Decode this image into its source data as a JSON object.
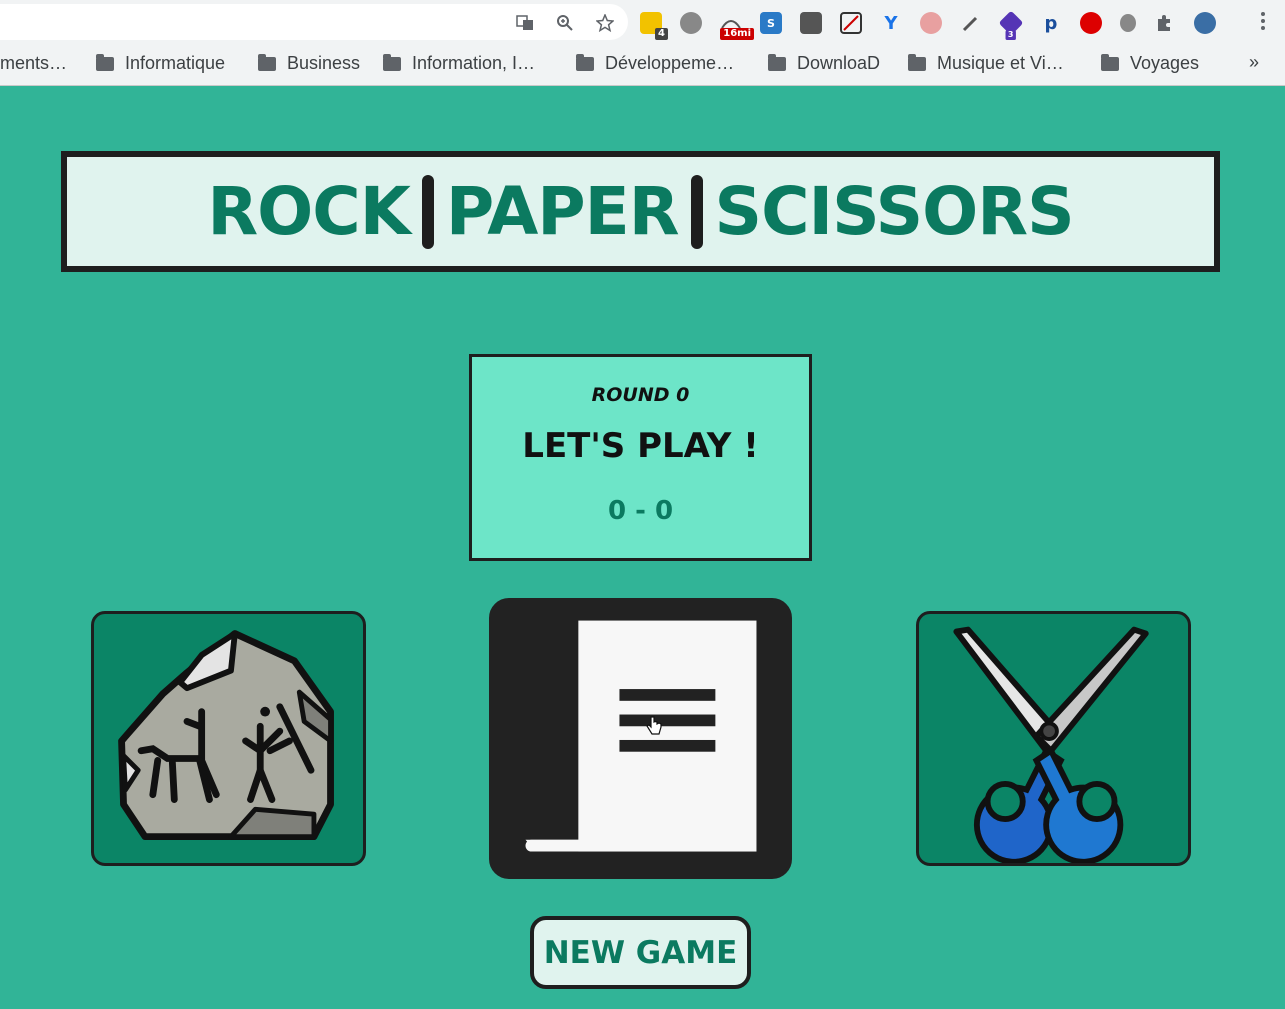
{
  "browser": {
    "bookmarks": [
      {
        "label": "ments…",
        "folder": false
      },
      {
        "label": "Informatique",
        "folder": true
      },
      {
        "label": "Business",
        "folder": true
      },
      {
        "label": "Information, I…",
        "folder": true
      },
      {
        "label": "Développeme…",
        "folder": true
      },
      {
        "label": "DownloaD",
        "folder": true
      },
      {
        "label": "Musique et Vi…",
        "folder": true
      },
      {
        "label": "Voyages",
        "folder": true
      }
    ],
    "more_bookmarks": "»",
    "extensions": {
      "badge_4": "4",
      "badge_16mi": "16mi",
      "badge_3": "3"
    }
  },
  "game": {
    "title": {
      "word1": "ROCK",
      "word2": "PAPER",
      "word3": "SCISSORS"
    },
    "status": {
      "round_label": "ROUND 0",
      "message": "LET'S PLAY !",
      "score": "0 - 0"
    },
    "choices": [
      "rock",
      "paper",
      "scissors"
    ],
    "new_game_label": "NEW GAME",
    "colors": {
      "page_bg": "#31b497",
      "accent": "#0b7a60",
      "status_bg": "#6de5c8",
      "title_bg": "#e0f3ee"
    }
  }
}
